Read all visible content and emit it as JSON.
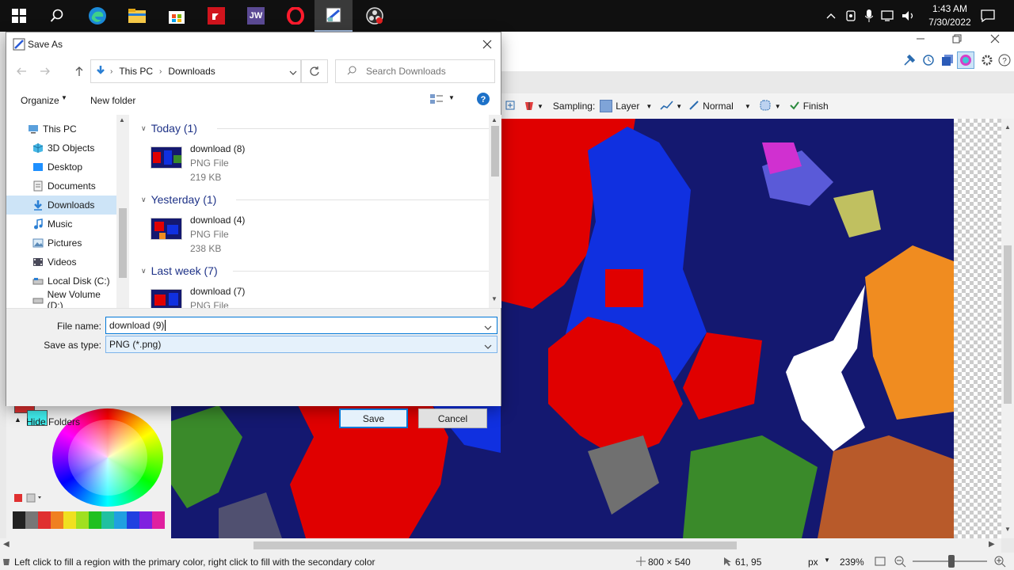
{
  "taskbar": {
    "apps": [
      "start-icon",
      "search-icon",
      "edge-icon",
      "file-explorer-icon",
      "store-icon",
      "amd-icon",
      "jw-icon",
      "opera-icon",
      "paint-net-icon",
      "obs-icon"
    ],
    "jw_label": "JW",
    "clock_time": "1:43 AM",
    "clock_date": "7/30/2022"
  },
  "paint_app": {
    "toolbar": {
      "sampling_label": "Sampling:",
      "layer_label": "Layer",
      "blend_mode": "Normal",
      "finish_label": "Finish"
    },
    "statusbar": {
      "hint": "Left click to fill a region with the primary color, right click to fill with the secondary color",
      "image_size": "800 × 540",
      "cursor_pos": "61, 95",
      "units": "px",
      "zoom": "239%"
    }
  },
  "dialog": {
    "title": "Save As",
    "breadcrumb": [
      "This PC",
      "Downloads"
    ],
    "search_placeholder": "Search Downloads",
    "organize_label": "Organize",
    "new_folder_label": "New folder",
    "nav_items": [
      {
        "label": "This PC",
        "icon": "computer-icon"
      },
      {
        "label": "3D Objects",
        "icon": "cube-icon"
      },
      {
        "label": "Desktop",
        "icon": "desktop-icon"
      },
      {
        "label": "Documents",
        "icon": "documents-icon"
      },
      {
        "label": "Downloads",
        "icon": "download-arrow-icon",
        "selected": true
      },
      {
        "label": "Music",
        "icon": "music-note-icon"
      },
      {
        "label": "Pictures",
        "icon": "pictures-icon"
      },
      {
        "label": "Videos",
        "icon": "videos-icon"
      },
      {
        "label": "Local Disk (C:)",
        "icon": "drive-icon"
      },
      {
        "label": "New Volume (D:)",
        "icon": "drive-icon"
      }
    ],
    "groups": [
      {
        "label": "Today (1)",
        "files": [
          {
            "name": "download (8)",
            "type": "PNG File",
            "size": "219 KB"
          }
        ]
      },
      {
        "label": "Yesterday (1)",
        "files": [
          {
            "name": "download (4)",
            "type": "PNG File",
            "size": "238 KB"
          }
        ]
      },
      {
        "label": "Last week (7)",
        "files": [
          {
            "name": "download (7)",
            "type": "PNG File",
            "size": ""
          }
        ]
      }
    ],
    "file_name_label": "File name:",
    "file_name_value": "download (9)",
    "save_type_label": "Save as type:",
    "save_type_value": "PNG (*.png)",
    "hide_folders_label": "Hide Folders",
    "save_label": "Save",
    "cancel_label": "Cancel"
  },
  "colors": {
    "accent": "#0078d7",
    "selected_nav": "#cde4f7",
    "group_header": "#1e3287",
    "canvas_red": "#e00000",
    "canvas_blue": "#1030e0",
    "canvas_navy": "#141870"
  }
}
